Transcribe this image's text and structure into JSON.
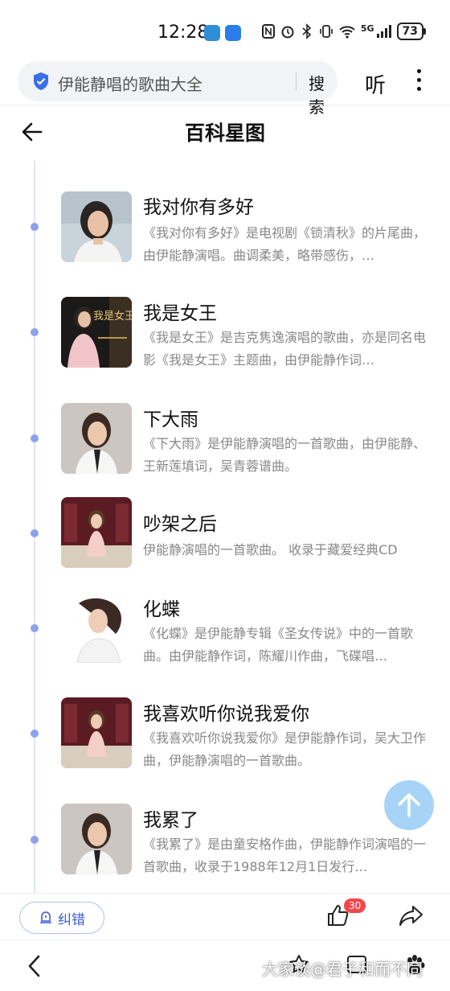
{
  "status_bar": {
    "time": "12:28",
    "network": "5G",
    "battery": "73"
  },
  "search": {
    "query": "伊能静唱的歌曲大全",
    "search_label": "搜索",
    "listen_label": "听"
  },
  "page": {
    "title": "百科星图"
  },
  "songs": [
    {
      "title": "我对你有多好",
      "desc": "《我对你有多好》是电视剧《锁清秋》的片尾曲，由伊能静演唱。曲调柔美，略带感伤，…"
    },
    {
      "title": "我是女王",
      "desc": "《我是女王》是吉克隽逸演唱的歌曲，亦是同名电影《我是女王》主题曲，由伊能静作词…",
      "cover_text": "我是女王"
    },
    {
      "title": "下大雨",
      "desc": "《下大雨》是伊能静演唱的一首歌曲，由伊能静、王新莲填词，吴青蓉谱曲。"
    },
    {
      "title": "吵架之后",
      "desc": "伊能静演唱的一首歌曲。 收录于藏爱经典CD"
    },
    {
      "title": "化蝶",
      "desc": "《化蝶》是伊能静专辑《圣女传说》中的一首歌曲。由伊能静作词，陈耀川作曲，飞碟唱…"
    },
    {
      "title": "我喜欢听你说我爱你",
      "desc": "《我喜欢听你说我爱你》是伊能静作词，吴大卫作曲，伊能静演唱的一首歌曲。"
    },
    {
      "title": "我累了",
      "desc": "《我累了》是由童安格作曲，伊能静作词演唱的一首歌曲，收录于1988年12月1日发行…"
    }
  ],
  "actions": {
    "report_label": "纠错",
    "like_count": "30"
  },
  "watermark": "大家谈@君子和而不同",
  "colors": {
    "accent_blue": "#3a5bd9",
    "timeline_dot": "#8da2ec",
    "badge_red": "#f3474c",
    "scroll_top": "#9ed0f6"
  }
}
